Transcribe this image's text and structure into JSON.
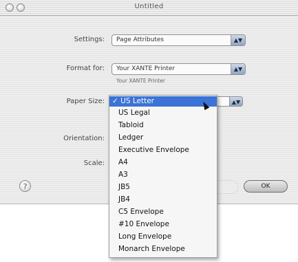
{
  "window": {
    "title": "Untitled"
  },
  "settings": {
    "label": "Settings:",
    "value": "Page Attributes"
  },
  "format_for": {
    "label": "Format for:",
    "value": "Your XANTE Printer",
    "subtext": "Your XANTE Printer"
  },
  "paper_size": {
    "label": "Paper Size:",
    "selected_mark": "✓",
    "options": [
      "US Letter",
      "US Legal",
      "Tabloid",
      "Ledger",
      "Executive Envelope",
      "A4",
      "A3",
      "JB5",
      "JB4",
      "C5 Envelope",
      "#10 Envelope",
      "Long Envelope",
      "Monarch Envelope"
    ],
    "selected_index": 0
  },
  "orientation": {
    "label": "Orientation:"
  },
  "scale": {
    "label": "Scale:"
  },
  "buttons": {
    "help": "?",
    "ok": "OK"
  },
  "icons": {
    "popup_arrows": "updown-arrows-icon",
    "help": "question-icon"
  },
  "colors": {
    "highlight": "#3b73d6",
    "popup_arrow_bg": "#8fa5c4"
  }
}
